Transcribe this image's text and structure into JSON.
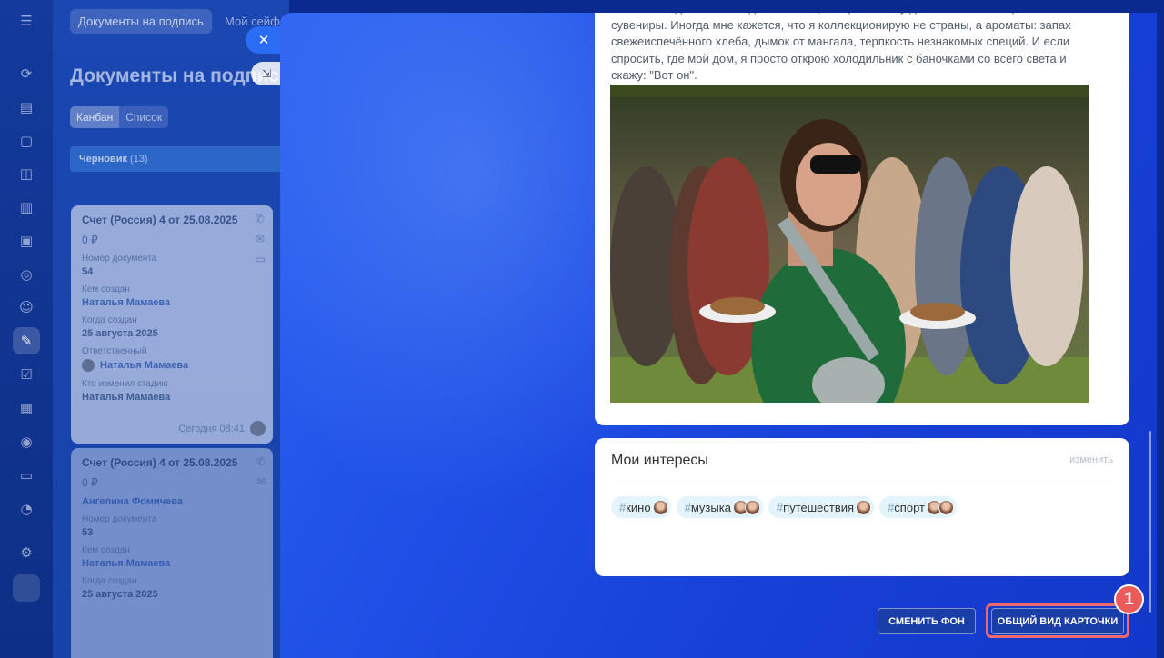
{
  "rail": {
    "icons": [
      "menu-icon",
      "activity-icon",
      "document-icon",
      "chat-icon",
      "archive-icon",
      "file-icon",
      "message-icon",
      "target-icon",
      "contacts-icon",
      "sign-icon",
      "task-icon",
      "calendar-icon",
      "robot-icon",
      "card-icon",
      "cart-icon",
      "settings-icon"
    ]
  },
  "background_page": {
    "tabs": [
      "Документы на подпись",
      "Мой сейф"
    ],
    "title": "Документы на подпись",
    "views": [
      "Канбан",
      "Список"
    ],
    "column": {
      "name": "Черновик",
      "count": "(13)"
    },
    "cards": [
      {
        "title": "Счет (Россия) 4 от 25.08.2025",
        "sum": "0 ₽",
        "fields": [
          {
            "label": "Номер документа",
            "value": "54"
          },
          {
            "label": "Кем создан",
            "value": "Наталья Мамаева"
          },
          {
            "label": "Когда создан",
            "value": "25 августа 2025"
          },
          {
            "label": "Ответственный",
            "value": "Наталья Мамаева"
          },
          {
            "label": "Кто изменил стадию",
            "value": "Наталья Мамаева"
          }
        ],
        "time": "Сегодня 08:41"
      },
      {
        "title": "Счет (Россия) 4 от 25.08.2025",
        "sum": "0 ₽",
        "fields": [
          {
            "label": "",
            "value": "Ангелина Фомичева"
          },
          {
            "label": "Номер документа",
            "value": "53"
          },
          {
            "label": "Кем создан",
            "value": "Наталья Мамаева"
          },
          {
            "label": "Когда создан",
            "value": "25 августа 2025"
          }
        ]
      }
    ]
  },
  "slider": {
    "post_text": "оставаться для местных деликатесов, которые я везу домой как самые ценные сувениры. Иногда мне кажется, что я коллекционирую не страны, а ароматы: запах свежеиспечённого хлеба, дымок от мангала, терпкость незнакомых специй. И если спросить, где мой дом, я просто открою холодильник с баночками со всего света и скажу: \"Вот он\".",
    "interests": {
      "title": "Мои интересы",
      "edit": "изменить",
      "tags": [
        {
          "name": "кино",
          "avatars": 1
        },
        {
          "name": "музыка",
          "avatars": 2
        },
        {
          "name": "путешествия",
          "avatars": 1
        },
        {
          "name": "спорт",
          "avatars": 2
        }
      ]
    },
    "buttons": {
      "change_bg": "СМЕНИТЬ ФОН",
      "card_view": "ОБЩИЙ ВИД КАРТОЧКИ"
    },
    "step_badge": "1"
  }
}
